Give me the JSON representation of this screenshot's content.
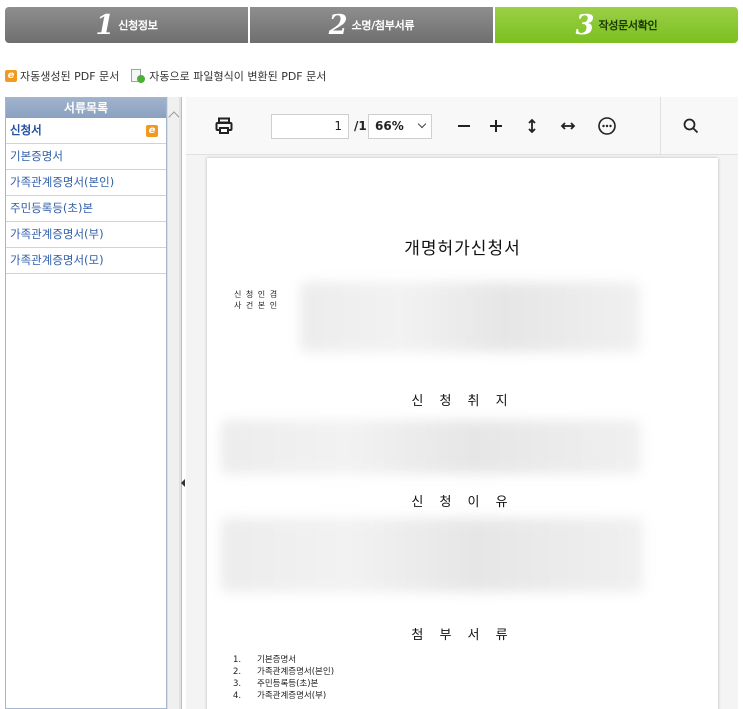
{
  "steps": [
    {
      "num": "1",
      "label": "신청정보"
    },
    {
      "num": "2",
      "label": "소명/첨부서류"
    },
    {
      "num": "3",
      "label": "작성문서확인"
    }
  ],
  "legend": {
    "auto_pdf": "자동생성된 PDF 문서",
    "converted_pdf": "자동으로 파일형식이 변환된 PDF 문서"
  },
  "doclist": {
    "header": "서류목록",
    "items": [
      "신청서",
      "기본증명서",
      "가족관계증명서(본인)",
      "주민등록등(초)본",
      "가족관계증명서(부)",
      "가족관계증명서(모)"
    ]
  },
  "viewer": {
    "page_current": "1",
    "page_total": "/1",
    "zoom": "66%"
  },
  "pdf": {
    "title": "개명허가신청서",
    "applicant_labels": [
      "신 청 인 겸",
      "사 건 본 인"
    ],
    "sections": [
      "신 청 취 지",
      "신 청 이 유",
      "첨 부 서 류"
    ],
    "attachments": [
      {
        "n": "1.",
        "text": "기본증명서"
      },
      {
        "n": "2.",
        "text": "가족관계증명서(본인)"
      },
      {
        "n": "3.",
        "text": "주민등록등(초)본"
      },
      {
        "n": "4.",
        "text": "가족관계증명서(부)"
      }
    ]
  },
  "icons": {
    "print": "print-icon",
    "zoom_out": "minus-icon",
    "zoom_in": "plus-icon",
    "fit_vertical": "vertical-arrows-icon",
    "fit_horizontal": "horizontal-arrows-icon",
    "more": "more-options-icon",
    "search": "search-icon"
  },
  "colors": {
    "step_inactive": "#7f7f7f",
    "step_active": "#8cc63f",
    "list_header": "#94aac6",
    "link": "#2f5fa8"
  }
}
